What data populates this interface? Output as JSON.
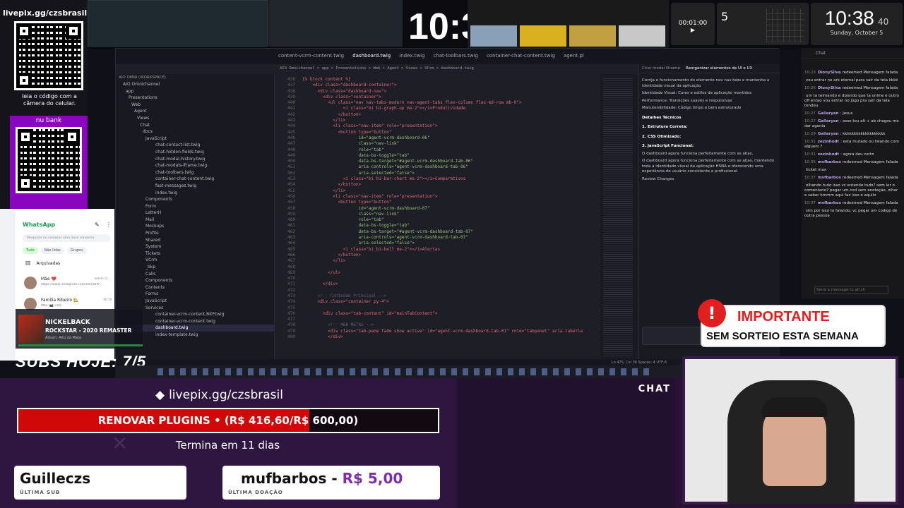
{
  "top": {
    "big_clock_partial": "10:3",
    "timer": "00:01:00",
    "calendar_day": "5",
    "clock_time": "10:38",
    "clock_seconds": "40",
    "clock_date": "Sunday, October 5"
  },
  "qr": {
    "url": "livepix.gg/czsbrasil",
    "caption": "leia o código com a câmera do celular.",
    "bank": "nu bank"
  },
  "editor": {
    "tabs": [
      "content-vcrm-content.twig",
      "dashboard.twig",
      "index.twig",
      "chat-toolbars.twig",
      "container-chat-content.twig",
      "agent.pl"
    ],
    "breadcrumb": "AIO Omnichannel > app > Presentations > Web > Agent > Views > VCrm > dashboard.twig",
    "explorer_title": "AIO OMNI (WORKSPACE)",
    "tree": [
      "AIO Omnichannel",
      "app",
      "Presentations",
      "Web",
      "Agent",
      "Views",
      "Chat",
      "docs",
      "JavaScript",
      "chat-contact-list.twig",
      "chat-hidden-fields.twig",
      "chat-modal-history.twig",
      "chat-modals-iframe.twig",
      "chat-toolbars.twig",
      "container-chat-content.twig",
      "fast-messages.twig",
      "index.twig",
      "Components",
      "Form",
      "LetterH",
      "Mail",
      "Mockups",
      "Profile",
      "Shared",
      "System",
      "Tickets",
      "VCrm",
      "_bkp",
      "Calls",
      "Components",
      "Contents",
      "Forms",
      "JavaScript",
      "Services",
      "container-vcrm-content.BKP.twig",
      "container-vcrm-content.twig",
      "dashboard.twig",
      "index-template.twig"
    ],
    "code": [
      {
        "n": "436",
        "t": "{% block content %}"
      },
      {
        "n": "437",
        "t": "    <div class=\"dashboard-container\">"
      },
      {
        "n": "438",
        "t": "      <div class=\"dashboard-nav\">"
      },
      {
        "n": "439",
        "t": "        <div class=\"container\">"
      },
      {
        "n": "440",
        "t": "          <ul class=\"nav nav-tabs-modern nav-agent-tabs flex-column flex-md-row mb-0\">"
      },
      {
        "n": "441",
        "t": "                <i class=\"bi bi-graph-up me-2\"></i>Produtividade"
      },
      {
        "n": "442",
        "t": "              </button>"
      },
      {
        "n": "443",
        "t": "            </li>"
      },
      {
        "n": "444",
        "t": "            <li class=\"nav-item\" role=\"presentation\">"
      },
      {
        "n": "445",
        "t": "              <button type=\"button\""
      },
      {
        "n": "446",
        "t": "                      id=\"agent-vcrm-dashboard-06\""
      },
      {
        "n": "447",
        "t": "                      class=\"nav-link\""
      },
      {
        "n": "448",
        "t": "                      role=\"tab\""
      },
      {
        "n": "449",
        "t": "                      data-bs-toggle=\"tab\""
      },
      {
        "n": "450",
        "t": "                      data-bs-target=\"#agent-vcrm-dashboard-tab-06\""
      },
      {
        "n": "451",
        "t": "                      aria-controls=\"agent-vcrm-dashboard-tab-06\""
      },
      {
        "n": "452",
        "t": "                      aria-selected=\"false\">"
      },
      {
        "n": "453",
        "t": "                <i class=\"bi bi-bar-chart me-2\"></i>Comparativos"
      },
      {
        "n": "454",
        "t": "              </button>"
      },
      {
        "n": "455",
        "t": "            </li>"
      },
      {
        "n": "456",
        "t": "            <li class=\"nav-item\" role=\"presentation\">"
      },
      {
        "n": "457",
        "t": "              <button type=\"button\""
      },
      {
        "n": "458",
        "t": "                      id=\"agent-vcrm-dashboard-07\""
      },
      {
        "n": "459",
        "t": "                      class=\"nav-link\""
      },
      {
        "n": "460",
        "t": "                      role=\"tab\""
      },
      {
        "n": "461",
        "t": "                      data-bs-toggle=\"tab\""
      },
      {
        "n": "462",
        "t": "                      data-bs-target=\"#agent-vcrm-dashboard-tab-07\""
      },
      {
        "n": "463",
        "t": "                      aria-controls=\"agent-vcrm-dashboard-tab-07\""
      },
      {
        "n": "464",
        "t": "                      aria-selected=\"false\">"
      },
      {
        "n": "465",
        "t": "                <i class=\"bi bi-bell me-2\"></i>Alertas"
      },
      {
        "n": "466",
        "t": "              </button>"
      },
      {
        "n": "467",
        "t": "            </li>"
      },
      {
        "n": "468",
        "t": ""
      },
      {
        "n": "469",
        "t": "          </ul>"
      },
      {
        "n": "470",
        "t": ""
      },
      {
        "n": "471",
        "t": "        </div>"
      },
      {
        "n": "472",
        "t": ""
      },
      {
        "n": "473",
        "t": "      <!-- Conteúdo Principal -->"
      },
      {
        "n": "474",
        "t": "      <div class=\"container py-4\">"
      },
      {
        "n": "475",
        "t": ""
      },
      {
        "n": "476",
        "t": "        <div class=\"tab-content\" id=\"mainTabContent\">"
      },
      {
        "n": "477",
        "t": ""
      },
      {
        "n": "478",
        "t": "          <!-- ABA METAS -->"
      },
      {
        "n": "479",
        "t": "          <div class=\"tab-pane fade show active\" id=\"agent-vcrm-dashboard-tab-01\" role=\"tabpanel\" aria-labelle"
      },
      {
        "n": "480",
        "t": "          </div>"
      }
    ],
    "chat_tabs": [
      "Criar modal illnome",
      "Reorganizar elementos de UI e UX"
    ],
    "chat_lines": [
      "Corrija o funcionamento do elemento nav nav-tabs e mantenha a identidade visual da aplicação",
      "Identidade Visual: Cores e estilos da aplicação mantidos",
      "Performance: Transições suaves e responsivas",
      "Manutenibilidade: Código limpo e bem estruturado",
      "Detalhes Técnicos",
      "1. Estrutura Correta:",
      "2. CSS Otimizado:",
      "3. JavaScript Funcional:",
      "O dashboard agora funciona perfeitamente com as abas,",
      "O dashboard agora funciona perfeitamente com as abas, mantendo toda a identidade visual da aplicação HSNA e oferecendo uma experiência de usuário consistente e profissional.",
      "Review Changes"
    ],
    "status": "Ln 475, Col 36   Spaces: 4   UTF-8"
  },
  "twitch_chat": {
    "title": "Chat",
    "messages": [
      {
        "time": "10:23",
        "user": "DionySilva",
        "text": "redeemed Mensagem falada"
      },
      {
        "time": "",
        "user": "",
        "text": "vou entrar no ark eternal para sair da tela kkkk"
      },
      {
        "time": "10:26",
        "user": "DionySilva",
        "text": "redeemed Mensagem falada"
      },
      {
        "time": "",
        "user": "",
        "text": "um ta teimando e dizendo que ta online e outro off entao vou entrar no jogo pra sair da tela tendeu"
      },
      {
        "time": "10:27",
        "user": "Gallaryan",
        "text": ": Jesus"
      },
      {
        "time": "10:27",
        "user": "Gallaryan",
        "text": ": esse tou alt + ab chegou me dar agonia"
      },
      {
        "time": "10:29",
        "user": "Gallaryan",
        "text": ": kkkkkkkkkkkkkkkkkkk"
      },
      {
        "time": "10:31",
        "user": "zezinhodt",
        "text": ": esta mutado ou falando com alguem ?"
      },
      {
        "time": "10:31",
        "user": "zezinhodt",
        "text": ": agora deu certo"
      },
      {
        "time": "10:35",
        "user": "mvfbarbos",
        "text": "redeemed Mensagem falada"
      },
      {
        "time": "",
        "user": "",
        "text": "ticket max"
      },
      {
        "time": "10:37",
        "user": "mvfbarbos",
        "text": "redeemed Mensagem falada"
      },
      {
        "time": "",
        "user": "",
        "text": "olhando tudo isso vc entende tudo? sem ler o comentario? pegar um cod sem anotação, olhar e saber hmmm aqui faz isso e aquilo"
      },
      {
        "time": "10:37",
        "user": "mvfbarbos",
        "text": "redeemed Mensagem falada"
      },
      {
        "time": "",
        "user": "",
        "text": "sim por isso to falando, vc pegar um codigo de outra pessoa"
      }
    ],
    "placeholder": "Send a message to all ch"
  },
  "whatsapp": {
    "title": "WhatsApp",
    "search_placeholder": "Pesquisar ou começar uma nova conversa",
    "filters": [
      "Tudo",
      "Não lidas",
      "Grupos"
    ],
    "archived": "Arquivadas",
    "chats": [
      {
        "name": "Mãe ❤️",
        "preview": "https://www.instagram.com/reel/DP0...",
        "time": "ontem 11:..."
      },
      {
        "name": "Família Ribeiro 🏡",
        "preview": "Mãe: 📷 Foto",
        "time": "00:19"
      }
    ]
  },
  "music": {
    "artist": "NICKELBACK",
    "track": "ROCKSTAR - 2020 REMASTER",
    "album": "Álbum: Alto da Mata"
  },
  "subs_hoje": "SUBS HOJE: 7/5",
  "donation": {
    "url": "livepix.gg/czsbrasil",
    "goal_label": "RENOVAR PLUGINS",
    "goal_progress_text": "(R$ 416,60/R$ 600,00)",
    "goal_current": 416.6,
    "goal_target": 600.0,
    "ends_text": "Termina em 11 dias",
    "last_sub_name": "Guilleczs",
    "last_sub_label": "ÚLTIMA SUB",
    "last_donation_name": "mufbarbos",
    "last_donation_amount": "R$ 5,00",
    "last_donation_label": "ÚLTIMA DOAÇÃO"
  },
  "chat_label": "CHAT",
  "important": {
    "title": "IMPORTANTE",
    "subtitle": "SEM SORTEIO ESTA SEMANA"
  },
  "colors": {
    "accent_purple": "#8a2be2",
    "goal_red": "#e01010",
    "donation_purple": "#6a1b9a",
    "important_red": "#e02020"
  }
}
